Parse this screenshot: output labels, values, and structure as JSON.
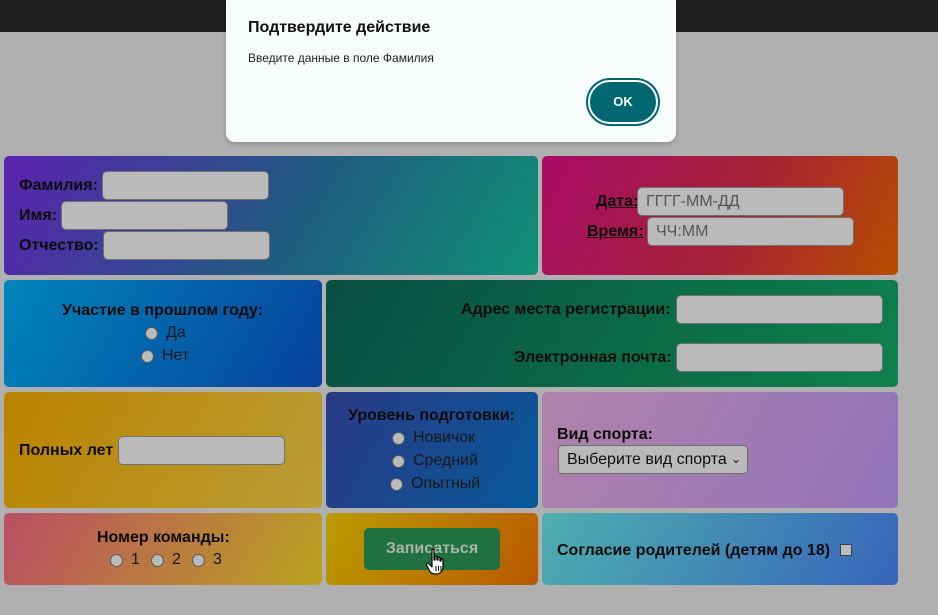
{
  "dialog": {
    "title": "Подтвердите действие",
    "message": "Введите данные в поле Фамилия",
    "ok_label": "OK"
  },
  "form": {
    "fio": {
      "surname_label": "Фамилия:",
      "name_label": "Имя:",
      "patronymic_label": "Отчество:"
    },
    "datetime": {
      "date_label": "Дата:",
      "date_placeholder": "ГГГГ-ММ-ДД",
      "time_label": "Время:",
      "time_placeholder": "ЧЧ:ММ"
    },
    "participation": {
      "label": "Участие в прошлом году:",
      "options": [
        "Да",
        "Нет"
      ]
    },
    "contacts": {
      "address_label": "Адрес места регистрации:",
      "email_label": "Электронная почта:"
    },
    "age": {
      "label": "Полных лет"
    },
    "level": {
      "label": "Уровень подготовки:",
      "options": [
        "Новичок",
        "Средний",
        "Опытный"
      ]
    },
    "sport": {
      "label": "Вид спорта:",
      "selected": "Выберите вид спорта"
    },
    "team": {
      "label": "Номер команды:",
      "options": [
        "1",
        "2",
        "3"
      ]
    },
    "submit_label": "Записаться",
    "consent_label": "Согласие родителей (детям до 18)"
  },
  "icons": {
    "dropdown": "chevron-down-icon",
    "cursor": "hand-pointer-icon"
  },
  "colors": {
    "dialog_button": "#006670",
    "submit_button": "#2c9c5a",
    "topbar": "#2b2b2b"
  }
}
